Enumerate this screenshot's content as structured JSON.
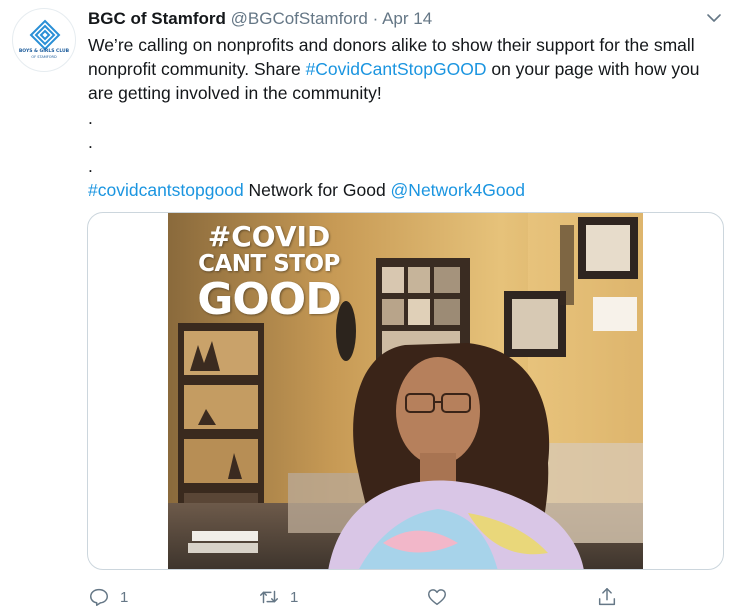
{
  "author": {
    "name": "BGC of Stamford",
    "handle": "@BGCofStamford",
    "separator": "·",
    "date": "Apr 14",
    "avatar_text_line1": "BOYS & GIRLS CLUB",
    "avatar_text_line2": "OF STAMFORD"
  },
  "tweet": {
    "text_part1": "We’re calling on nonprofits and donors alike to show their support for the small nonprofit community. Share ",
    "hashtag1": "#CovidCantStopGOOD",
    "text_part2": " on your page with how you are getting involved in the community!",
    "dots": [
      ".",
      ".",
      "."
    ],
    "hashtag2": "#covidcantstopgood",
    "text_part3": " Network for Good ",
    "mention": "@Network4Good"
  },
  "media": {
    "overlay_line1": "#COVID",
    "overlay_line2": "CANT STOP",
    "overlay_line3": "GOOD"
  },
  "actions": {
    "reply_count": "1",
    "retweet_count": "1",
    "like_count": "",
    "share_count": ""
  },
  "colors": {
    "link": "#1b95e0",
    "secondary_text": "#657786",
    "border": "#ccd6dd"
  },
  "icons": [
    "chevron-down-icon",
    "reply-icon",
    "retweet-icon",
    "like-icon",
    "share-icon"
  ]
}
